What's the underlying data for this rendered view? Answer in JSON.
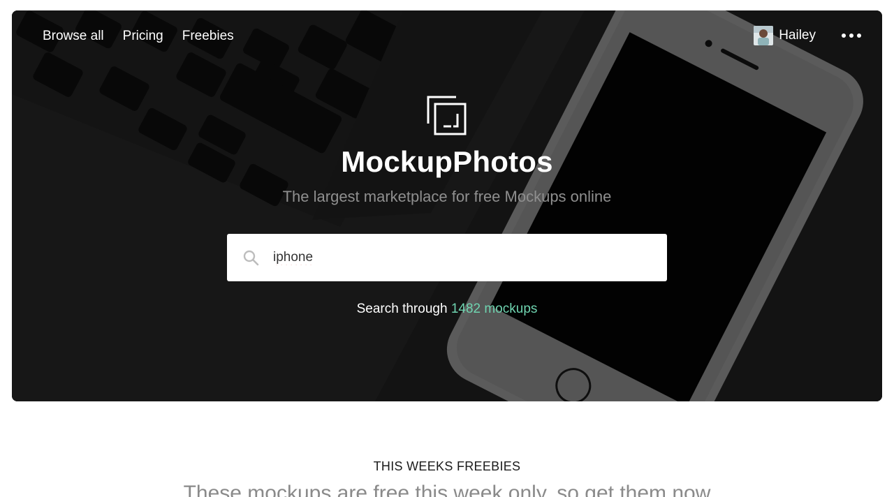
{
  "nav": {
    "links": [
      "Browse all",
      "Pricing",
      "Freebies"
    ],
    "user_name": "Hailey"
  },
  "hero": {
    "brand": "MockupPhotos",
    "tagline": "The largest marketplace for free Mockups online",
    "search": {
      "value": "iphone",
      "placeholder": ""
    },
    "count_prefix": "Search through ",
    "count_text": "1482 mockups"
  },
  "section": {
    "title": "THIS WEEKS FREEBIES",
    "subtitle": "These mockups are free this week only, so get them now"
  },
  "colors": {
    "accent": "#6fd4b0",
    "hero_overlay": "#2a2a2a"
  },
  "icons": [
    "logo-icon",
    "search-icon",
    "more-icon",
    "avatar"
  ]
}
